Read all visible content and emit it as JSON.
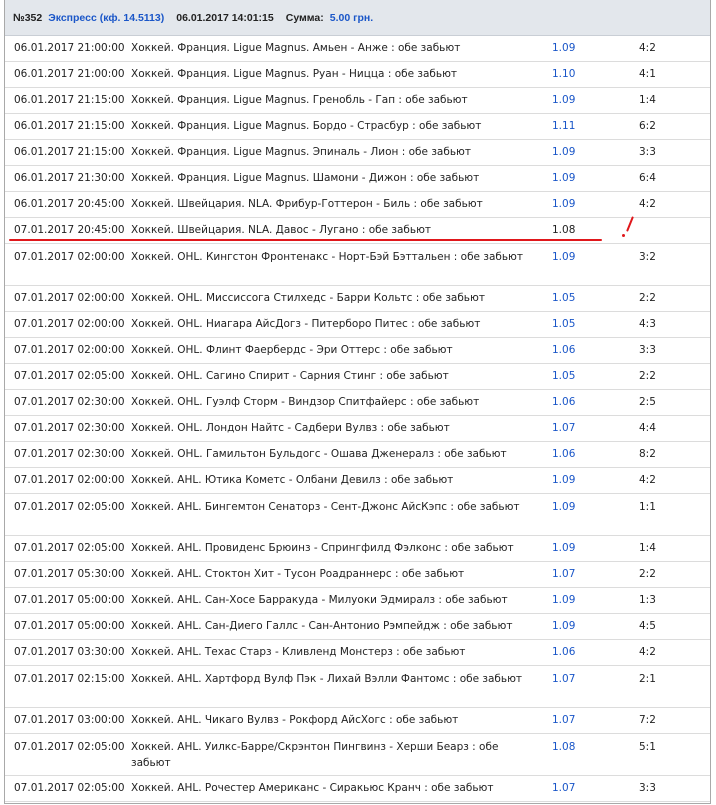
{
  "header": {
    "bet_number": "№352",
    "bet_type": "Экспресс (кф. 14.5113)",
    "datetime": "06.01.2017 14:01:15",
    "sum_label": "Сумма:",
    "sum_value": "5.00 грн."
  },
  "rows": [
    {
      "date": "06.01.2017 21:00:00",
      "event": "Хоккей. Франция. Ligue Magnus. Амьен - Анже : обе забьют",
      "odd": "1.09",
      "score": "4:2"
    },
    {
      "date": "06.01.2017 21:00:00",
      "event": "Хоккей. Франция. Ligue Magnus. Руан - Ницца : обе забьют",
      "odd": "1.10",
      "score": "4:1"
    },
    {
      "date": "06.01.2017 21:15:00",
      "event": "Хоккей. Франция. Ligue Magnus. Гренобль - Гап : обе забьют",
      "odd": "1.09",
      "score": "1:4"
    },
    {
      "date": "06.01.2017 21:15:00",
      "event": "Хоккей. Франция. Ligue Magnus. Бордо - Страсбур : обе забьют",
      "odd": "1.11",
      "score": "6:2"
    },
    {
      "date": "06.01.2017 21:15:00",
      "event": "Хоккей. Франция. Ligue Magnus. Эпиналь - Лион : обе забьют",
      "odd": "1.09",
      "score": "3:3"
    },
    {
      "date": "06.01.2017 21:30:00",
      "event": "Хоккей. Франция. Ligue Magnus. Шамони - Дижон : обе забьют",
      "odd": "1.09",
      "score": "6:4"
    },
    {
      "date": "06.01.2017 20:45:00",
      "event": "Хоккей. Швейцария. NLA. Фрибур-Готтерон - Биль : обе забьют",
      "odd": "1.09",
      "score": "4:2"
    },
    {
      "date": "07.01.2017 20:45:00",
      "event": "Хоккей. Швейцария. NLA. Давос - Лугано : обе забьют",
      "odd": "1.08",
      "score": ""
    },
    {
      "date": "07.01.2017 02:00:00",
      "event": "Хоккей. OHL. Кингстон Фронтенакс - Норт-Бэй Бэттальен : обе забьют",
      "odd": "1.09",
      "score": "3:2"
    },
    {
      "date": "07.01.2017 02:00:00",
      "event": "Хоккей. OHL. Миссиссога Стилхедс - Барри Кольтс : обе забьют",
      "odd": "1.05",
      "score": "2:2"
    },
    {
      "date": "07.01.2017 02:00:00",
      "event": "Хоккей. OHL. Ниагара АйсДогз - Питерборо Питес : обе забьют",
      "odd": "1.05",
      "score": "4:3"
    },
    {
      "date": "07.01.2017 02:00:00",
      "event": "Хоккей. OHL. Флинт Фаербердс - Эри Оттерс : обе забьют",
      "odd": "1.06",
      "score": "3:3"
    },
    {
      "date": "07.01.2017 02:05:00",
      "event": "Хоккей. OHL. Сагино Спирит - Сарния Стинг : обе забьют",
      "odd": "1.05",
      "score": "2:2"
    },
    {
      "date": "07.01.2017 02:30:00",
      "event": "Хоккей. OHL. Гуэлф Сторм - Виндзор Спитфайерс : обе забьют",
      "odd": "1.06",
      "score": "2:5"
    },
    {
      "date": "07.01.2017 02:30:00",
      "event": "Хоккей. OHL. Лондон Найтс - Садбери Вулвз : обе забьют",
      "odd": "1.07",
      "score": "4:4"
    },
    {
      "date": "07.01.2017 02:30:00",
      "event": "Хоккей. OHL. Гамильтон Бульдогс - Ошава Дженералз : обе забьют",
      "odd": "1.06",
      "score": "8:2"
    },
    {
      "date": "07.01.2017 02:00:00",
      "event": "Хоккей. AHL. Ютика Кометс - Олбани Девилз : обе забьют",
      "odd": "1.09",
      "score": "4:2"
    },
    {
      "date": "07.01.2017 02:05:00",
      "event": "Хоккей. AHL. Бингемтон Сенаторз - Сент-Джонс АйсКэпс : обе забьют",
      "odd": "1.09",
      "score": "1:1"
    },
    {
      "date": "07.01.2017 02:05:00",
      "event": "Хоккей. AHL. Провиденс Брюинз - Спрингфилд Фэлконс : обе забьют",
      "odd": "1.09",
      "score": "1:4"
    },
    {
      "date": "07.01.2017 05:30:00",
      "event": "Хоккей. AHL. Стоктон Хит - Тусон Роадраннерс : обе забьют",
      "odd": "1.07",
      "score": "2:2"
    },
    {
      "date": "07.01.2017 05:00:00",
      "event": "Хоккей. AHL. Сан-Хосе Барракуда - Милуоки Эдмиралз : обе забьют",
      "odd": "1.09",
      "score": "1:3"
    },
    {
      "date": "07.01.2017 05:00:00",
      "event": "Хоккей. AHL. Сан-Диего Галлс - Сан-Антонио Рэмпейдж : обе забьют",
      "odd": "1.09",
      "score": "4:5"
    },
    {
      "date": "07.01.2017 03:30:00",
      "event": "Хоккей. AHL. Техас Старз - Кливленд Монстерз : обе забьют",
      "odd": "1.06",
      "score": "4:2"
    },
    {
      "date": "07.01.2017 02:15:00",
      "event": "Хоккей. AHL. Хартфорд Вулф Пэк - Лихай Вэлли Фантомс : обе забьют",
      "odd": "1.07",
      "score": "2:1"
    },
    {
      "date": "07.01.2017 03:00:00",
      "event": "Хоккей. AHL. Чикаго Вулвз - Рокфорд АйсХогс : обе забьют",
      "odd": "1.07",
      "score": "7:2"
    },
    {
      "date": "07.01.2017 02:05:00",
      "event": "Хоккей. AHL. Уилкс-Барре/Скрэнтон Пингвинз - Херши Беарз : обе забьют",
      "odd": "1.08",
      "score": "5:1"
    },
    {
      "date": "07.01.2017 02:05:00",
      "event": "Хоккей. AHL. Рочестер Американс - Сиракьюс Кранч : обе забьют",
      "odd": "1.07",
      "score": "3:3"
    }
  ],
  "colors": {
    "link": "#1a56c8",
    "header_bg": "#e3e7ec",
    "annotation": "#e0171b"
  }
}
